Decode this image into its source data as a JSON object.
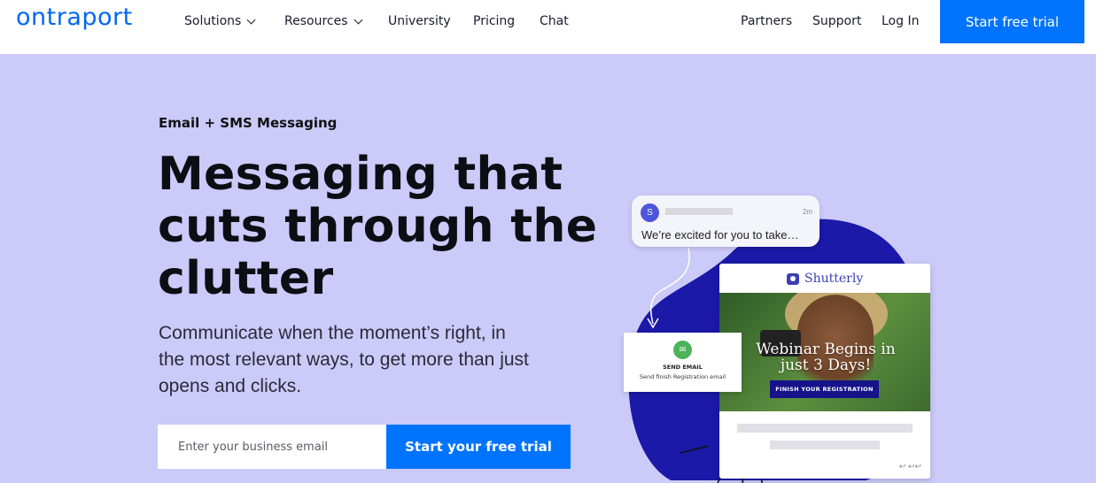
{
  "header": {
    "logo": "ontraport",
    "nav_left": [
      {
        "label": "Solutions",
        "dropdown": true
      },
      {
        "label": "Resources",
        "dropdown": true
      },
      {
        "label": "University",
        "dropdown": false
      },
      {
        "label": "Pricing",
        "dropdown": false
      },
      {
        "label": "Chat",
        "dropdown": false
      }
    ],
    "nav_right": [
      {
        "label": "Partners"
      },
      {
        "label": "Support"
      },
      {
        "label": "Log In"
      }
    ],
    "cta_label": "Start free trial"
  },
  "hero": {
    "eyebrow": "Email + SMS Messaging",
    "headline": "Messaging that cuts through the clutter",
    "subhead": "Communicate when the moment’s right, in the most relevant ways, to get more than just opens and clicks.",
    "email_placeholder": "Enter your business email",
    "cta_label": "Start your free trial"
  },
  "illustration": {
    "message": {
      "avatar_initial": "S",
      "time": "2m",
      "text": "We’re excited for you to take…"
    },
    "send_email": {
      "title": "SEND EMAIL",
      "subtitle": "Send finish Registration email"
    },
    "email_preview": {
      "brand": "Shutterly",
      "headline": "Webinar Begins in just 3 Days!",
      "button": "FINISH YOUR REGISTRATION"
    }
  },
  "colors": {
    "brand_blue": "#0074ff",
    "hero_bg": "#cccaf8",
    "blob": "#1a19a8",
    "send_icon": "#4cb35a"
  }
}
